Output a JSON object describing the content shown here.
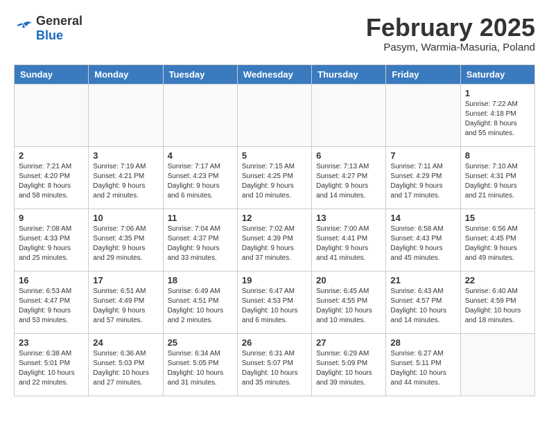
{
  "header": {
    "logo_general": "General",
    "logo_blue": "Blue",
    "month_year": "February 2025",
    "location": "Pasym, Warmia-Masuria, Poland"
  },
  "weekdays": [
    "Sunday",
    "Monday",
    "Tuesday",
    "Wednesday",
    "Thursday",
    "Friday",
    "Saturday"
  ],
  "weeks": [
    [
      {
        "day": "",
        "info": ""
      },
      {
        "day": "",
        "info": ""
      },
      {
        "day": "",
        "info": ""
      },
      {
        "day": "",
        "info": ""
      },
      {
        "day": "",
        "info": ""
      },
      {
        "day": "",
        "info": ""
      },
      {
        "day": "1",
        "info": "Sunrise: 7:22 AM\nSunset: 4:18 PM\nDaylight: 8 hours\nand 55 minutes."
      }
    ],
    [
      {
        "day": "2",
        "info": "Sunrise: 7:21 AM\nSunset: 4:20 PM\nDaylight: 8 hours\nand 58 minutes."
      },
      {
        "day": "3",
        "info": "Sunrise: 7:19 AM\nSunset: 4:21 PM\nDaylight: 9 hours\nand 2 minutes."
      },
      {
        "day": "4",
        "info": "Sunrise: 7:17 AM\nSunset: 4:23 PM\nDaylight: 9 hours\nand 6 minutes."
      },
      {
        "day": "5",
        "info": "Sunrise: 7:15 AM\nSunset: 4:25 PM\nDaylight: 9 hours\nand 10 minutes."
      },
      {
        "day": "6",
        "info": "Sunrise: 7:13 AM\nSunset: 4:27 PM\nDaylight: 9 hours\nand 14 minutes."
      },
      {
        "day": "7",
        "info": "Sunrise: 7:11 AM\nSunset: 4:29 PM\nDaylight: 9 hours\nand 17 minutes."
      },
      {
        "day": "8",
        "info": "Sunrise: 7:10 AM\nSunset: 4:31 PM\nDaylight: 9 hours\nand 21 minutes."
      }
    ],
    [
      {
        "day": "9",
        "info": "Sunrise: 7:08 AM\nSunset: 4:33 PM\nDaylight: 9 hours\nand 25 minutes."
      },
      {
        "day": "10",
        "info": "Sunrise: 7:06 AM\nSunset: 4:35 PM\nDaylight: 9 hours\nand 29 minutes."
      },
      {
        "day": "11",
        "info": "Sunrise: 7:04 AM\nSunset: 4:37 PM\nDaylight: 9 hours\nand 33 minutes."
      },
      {
        "day": "12",
        "info": "Sunrise: 7:02 AM\nSunset: 4:39 PM\nDaylight: 9 hours\nand 37 minutes."
      },
      {
        "day": "13",
        "info": "Sunrise: 7:00 AM\nSunset: 4:41 PM\nDaylight: 9 hours\nand 41 minutes."
      },
      {
        "day": "14",
        "info": "Sunrise: 6:58 AM\nSunset: 4:43 PM\nDaylight: 9 hours\nand 45 minutes."
      },
      {
        "day": "15",
        "info": "Sunrise: 6:56 AM\nSunset: 4:45 PM\nDaylight: 9 hours\nand 49 minutes."
      }
    ],
    [
      {
        "day": "16",
        "info": "Sunrise: 6:53 AM\nSunset: 4:47 PM\nDaylight: 9 hours\nand 53 minutes."
      },
      {
        "day": "17",
        "info": "Sunrise: 6:51 AM\nSunset: 4:49 PM\nDaylight: 9 hours\nand 57 minutes."
      },
      {
        "day": "18",
        "info": "Sunrise: 6:49 AM\nSunset: 4:51 PM\nDaylight: 10 hours\nand 2 minutes."
      },
      {
        "day": "19",
        "info": "Sunrise: 6:47 AM\nSunset: 4:53 PM\nDaylight: 10 hours\nand 6 minutes."
      },
      {
        "day": "20",
        "info": "Sunrise: 6:45 AM\nSunset: 4:55 PM\nDaylight: 10 hours\nand 10 minutes."
      },
      {
        "day": "21",
        "info": "Sunrise: 6:43 AM\nSunset: 4:57 PM\nDaylight: 10 hours\nand 14 minutes."
      },
      {
        "day": "22",
        "info": "Sunrise: 6:40 AM\nSunset: 4:59 PM\nDaylight: 10 hours\nand 18 minutes."
      }
    ],
    [
      {
        "day": "23",
        "info": "Sunrise: 6:38 AM\nSunset: 5:01 PM\nDaylight: 10 hours\nand 22 minutes."
      },
      {
        "day": "24",
        "info": "Sunrise: 6:36 AM\nSunset: 5:03 PM\nDaylight: 10 hours\nand 27 minutes."
      },
      {
        "day": "25",
        "info": "Sunrise: 6:34 AM\nSunset: 5:05 PM\nDaylight: 10 hours\nand 31 minutes."
      },
      {
        "day": "26",
        "info": "Sunrise: 6:31 AM\nSunset: 5:07 PM\nDaylight: 10 hours\nand 35 minutes."
      },
      {
        "day": "27",
        "info": "Sunrise: 6:29 AM\nSunset: 5:09 PM\nDaylight: 10 hours\nand 39 minutes."
      },
      {
        "day": "28",
        "info": "Sunrise: 6:27 AM\nSunset: 5:11 PM\nDaylight: 10 hours\nand 44 minutes."
      },
      {
        "day": "",
        "info": ""
      }
    ]
  ]
}
